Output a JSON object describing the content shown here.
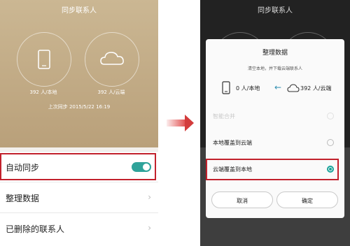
{
  "left": {
    "title": "同步联系人",
    "local_count": "392 人/本地",
    "cloud_count": "392 人/云端",
    "last_sync": "上次同步 2015/5/22 16:19",
    "rows": [
      {
        "label": "自动同步",
        "toggle": true
      },
      {
        "label": "整理数据"
      },
      {
        "label": "已删除的联系人"
      }
    ]
  },
  "right": {
    "title": "同步联系人",
    "dialog": {
      "title": "整理数据",
      "subtitle": "清空本地，并下载云端联系人",
      "local_value": "0 人/本地",
      "cloud_value": "392 人/云端",
      "options": [
        {
          "label": "智能合并",
          "state": "disabled"
        },
        {
          "label": "本地覆盖到云端",
          "state": "unselected"
        },
        {
          "label": "云端覆盖到本地",
          "state": "selected"
        }
      ],
      "cancel_label": "取消",
      "confirm_label": "确定"
    }
  },
  "colors": {
    "accent": "#1aa39a",
    "highlight": "#c2212c",
    "arrow": "#d33c3c"
  }
}
